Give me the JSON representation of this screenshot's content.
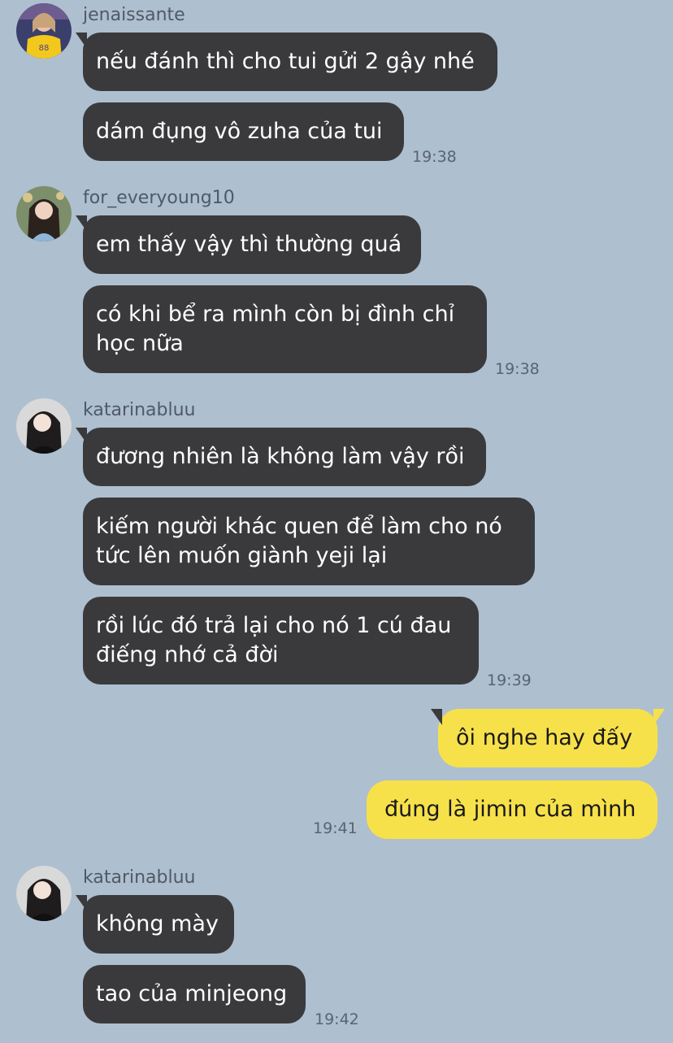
{
  "groups": [
    {
      "username": "jenaissante",
      "messages": [
        "nếu đánh thì cho tui gửi 2 gậy nhé",
        "dám đụng vô zuha của tui"
      ],
      "time": "19:38"
    },
    {
      "username": "for_everyoung10",
      "messages": [
        "em thấy vậy thì thường quá",
        "có khi bể ra mình còn bị đình chỉ",
        "học nữa"
      ],
      "time": "19:38"
    },
    {
      "username": "katarinabluu",
      "messages": [
        "đương nhiên là không làm vậy rồi",
        "kiếm người khác quen để làm cho nó",
        "tức lên muốn giành yeji lại",
        "rồi lúc đó trả lại cho nó 1 cú đau",
        "điếng nhớ cả đời"
      ],
      "time": "19:39"
    },
    {
      "username": "katarinabluu",
      "messages": [
        "không mày",
        "tao của minjeong"
      ],
      "time": "19:42"
    }
  ],
  "mine": {
    "messages": [
      "ôi nghe hay đấy",
      "đúng là jimin của mình"
    ],
    "time": "19:41"
  },
  "colors": {
    "background": "#aebfcf",
    "incoming_bubble": "#3a3a3c",
    "outgoing_bubble": "#f7e14b"
  },
  "icons": {
    "avatar_1": "user-avatar-yellow-jersey",
    "avatar_2": "user-avatar-long-hair",
    "avatar_3": "user-avatar-dark-hair",
    "avatar_4": "user-avatar-dark-hair"
  }
}
